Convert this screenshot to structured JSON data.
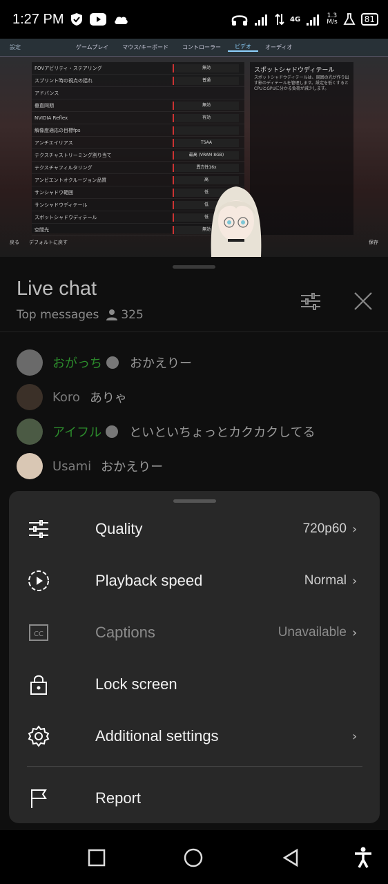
{
  "status": {
    "time": "1:27 PM",
    "net_speed_value": "1.3",
    "net_speed_unit": "M/s",
    "network_type": "4G",
    "battery": "81"
  },
  "game": {
    "settings_label": "設定",
    "tabs": [
      "ゲームプレイ",
      "マウス/キーボード",
      "コントローラー",
      "ビデオ",
      "オーディオ"
    ],
    "active_tab": 3,
    "rows": [
      {
        "label": "FOVアビリティ・ステアリング",
        "value": "無効"
      },
      {
        "label": "スプリント時の視点の揺れ",
        "value": "普通"
      },
      {
        "label": "アドバンス",
        "value": ""
      },
      {
        "label": "垂直同期",
        "value": "無効"
      },
      {
        "label": "NVIDIA Reflex",
        "value": "有効"
      },
      {
        "label": "解像度適応の目標fps",
        "value": ""
      },
      {
        "label": "アンチエイリアス",
        "value": "TSAA"
      },
      {
        "label": "テクスチャストリーミング割り当て",
        "value": "最高 (VRAM 8GB)"
      },
      {
        "label": "テクスチャフィルタリング",
        "value": "異方性16x"
      },
      {
        "label": "アンビエントオクルージョン品質",
        "value": "高"
      },
      {
        "label": "サンシャドウ範囲",
        "value": "低"
      },
      {
        "label": "サンシャドウディテール",
        "value": "低"
      },
      {
        "label": "スポットシャドウディテール",
        "value": "低"
      },
      {
        "label": "空間光",
        "value": "無効"
      }
    ],
    "side_title": "スポットシャドウディテール",
    "side_desc": "スポットシャドウディテールは、周囲の光が作り出す影のディテールを管理します。設定を低くするとCPUとGPUに分かる負荷が減少します。",
    "bottom_back": "戻る",
    "bottom_default": "デフォルトに戻す",
    "bottom_save": "保存"
  },
  "chat": {
    "title": "Live chat",
    "mode": "Top messages",
    "viewers": "325",
    "messages": [
      {
        "author": "おがっち",
        "text": "おかえりー",
        "member": true,
        "avatar_color": "#6a6a6a"
      },
      {
        "author": "Koro",
        "text": "ありゃ",
        "member": false,
        "avatar_color": "#3b3028"
      },
      {
        "author": "アイフル",
        "text": "といといちょっとカクカクしてる",
        "member": true,
        "avatar_color": "#4b5a44"
      },
      {
        "author": "Usami",
        "text": "おかえりー",
        "member": false,
        "avatar_color": "#d9c7b4"
      }
    ]
  },
  "sheet": {
    "items": [
      {
        "label": "Quality",
        "value": "720p60",
        "icon": "sliders-icon",
        "chevron": true,
        "disabled": false
      },
      {
        "label": "Playback speed",
        "value": "Normal",
        "icon": "playback-speed-icon",
        "chevron": true,
        "disabled": false
      },
      {
        "label": "Captions",
        "value": "Unavailable",
        "icon": "captions-icon",
        "chevron": true,
        "disabled": true
      },
      {
        "label": "Lock screen",
        "value": "",
        "icon": "lock-icon",
        "chevron": false,
        "disabled": false
      },
      {
        "label": "Additional settings",
        "value": "",
        "icon": "gear-icon",
        "chevron": true,
        "disabled": false
      },
      {
        "label": "Report",
        "value": "",
        "icon": "flag-icon",
        "chevron": false,
        "disabled": false
      }
    ]
  },
  "colors": {
    "member_name": "#2c8c2c",
    "sheet_bg": "#282828",
    "chat_bg": "#0f0f0f"
  }
}
